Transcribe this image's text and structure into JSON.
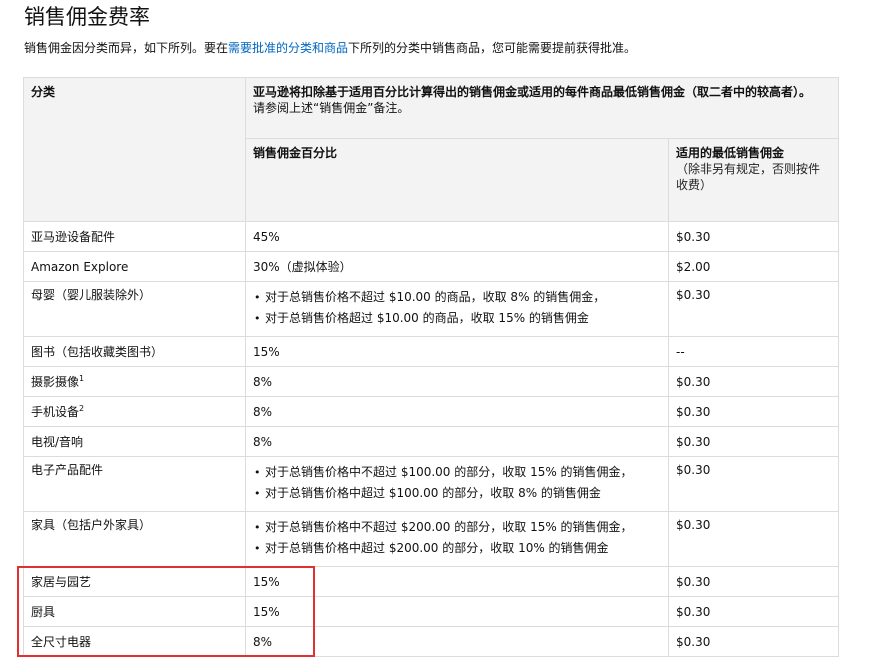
{
  "page": {
    "title": "销售佣金费率",
    "intro": {
      "before": "销售佣金因分类而异，如下所列。要在",
      "link": "需要批准的分类和商品",
      "after": "下所列的分类中销售商品，您可能需要提前获得批准。"
    }
  },
  "table": {
    "header": {
      "category": "分类",
      "summary": "亚马逊将扣除基于适用百分比计算得出的销售佣金或适用的每件商品最低销售佣金（取二者中的较高者）。",
      "summary_note": "请参阅上述“销售佣金”备注。",
      "percent": "销售佣金百分比",
      "minimum": "适用的最低销售佣金",
      "minimum_note": "（除非另有规定，否则按件收费）"
    },
    "rows": [
      {
        "category": "亚马逊设备配件",
        "rate": "45%",
        "min": "$0.30"
      },
      {
        "category": "Amazon Explore",
        "rate": "30%（虚拟体验）",
        "min": "$2.00"
      },
      {
        "category": "母婴（婴儿服装除外）",
        "rates": [
          "对于总销售价格不超过 $10.00 的商品，收取 8% 的销售佣金，",
          "对于总销售价格超过 $10.00 的商品，收取 15% 的销售佣金"
        ],
        "min": "$0.30"
      },
      {
        "category": "图书（包括收藏类图书）",
        "rate": "15%",
        "min": "--"
      },
      {
        "category": "摄影摄像",
        "sup": "1",
        "rate": "8%",
        "min": "$0.30"
      },
      {
        "category": "手机设备",
        "sup": "2",
        "rate": "8%",
        "min": "$0.30"
      },
      {
        "category": "电视/音响",
        "rate": "8%",
        "min": "$0.30"
      },
      {
        "category": "电子产品配件",
        "rates": [
          "对于总销售价格中不超过 $100.00 的部分，收取 15% 的销售佣金，",
          "对于总销售价格中超过 $100.00 的部分，收取 8% 的销售佣金"
        ],
        "min": "$0.30"
      },
      {
        "category": "家具（包括户外家具）",
        "rates": [
          "对于总销售价格中不超过 $200.00 的部分，收取 15% 的销售佣金，",
          "对于总销售价格中超过 $200.00 的部分，收取 10% 的销售佣金"
        ],
        "min": "$0.30"
      },
      {
        "category": "家居与园艺",
        "rate": "15%",
        "min": "$0.30"
      },
      {
        "category": "厨具",
        "rate": "15%",
        "min": "$0.30"
      },
      {
        "category": "全尺寸电器",
        "rate": "8%",
        "min": "$0.30"
      }
    ]
  },
  "colors": {
    "link": "#0066c0",
    "header_bg": "#f3f3f3",
    "border": "#dcdcdc",
    "highlight_box": "#e03030"
  }
}
